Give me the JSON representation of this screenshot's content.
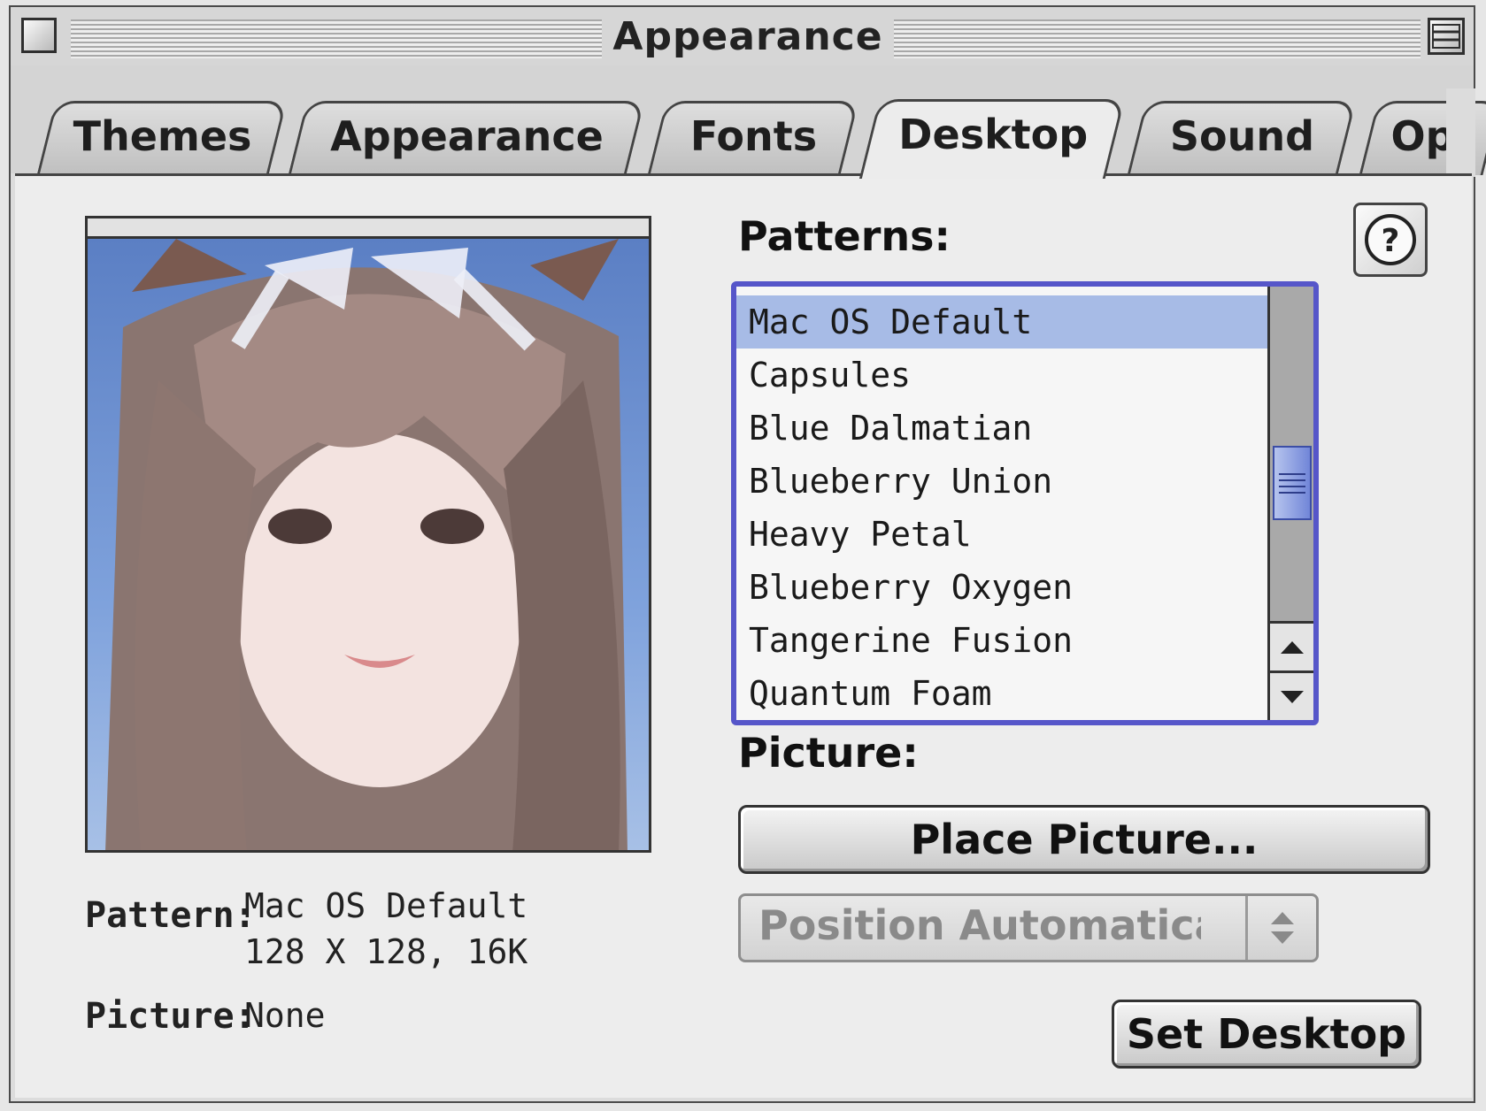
{
  "window": {
    "title": "Appearance"
  },
  "tabs": [
    {
      "label": "Themes"
    },
    {
      "label": "Appearance"
    },
    {
      "label": "Fonts"
    },
    {
      "label": "Desktop"
    },
    {
      "label": "Sound"
    },
    {
      "label": "Op"
    }
  ],
  "active_tab": "Desktop",
  "patterns": {
    "label": "Patterns:",
    "selected": "Mac OS Default",
    "items": [
      "Mac OS Default",
      "Capsules",
      "Blue Dalmatian",
      "Blueberry Union",
      "Heavy Petal",
      "Blueberry Oxygen",
      "Tangerine Fusion",
      "Quantum Foam"
    ]
  },
  "help_icon": "question-mark-icon",
  "picture": {
    "label": "Picture:",
    "place_button": "Place Picture...",
    "position_popup": "Position Automatically"
  },
  "info": {
    "pattern_label": "Pattern:",
    "pattern_name": "Mac OS Default",
    "pattern_size": "128 X 128, 16K",
    "picture_label": "Picture:",
    "picture_value": "None"
  },
  "set_desktop_button": "Set Desktop",
  "colors": {
    "selection": "#a7bbe6",
    "list_focus": "#5656c9",
    "scroll_thumb": "#7186d8"
  }
}
